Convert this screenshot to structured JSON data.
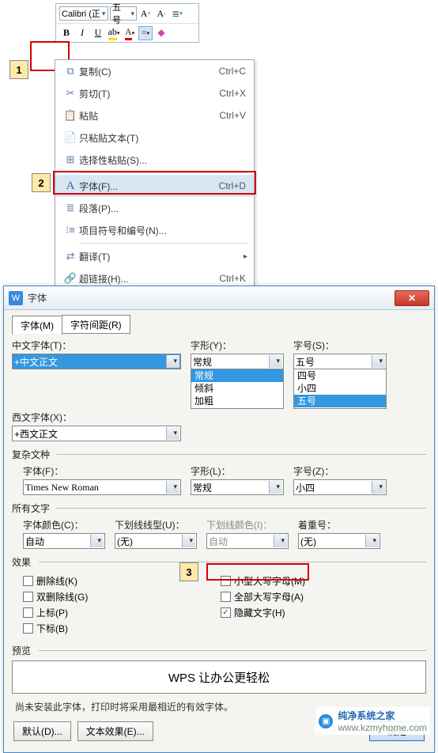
{
  "toolbar": {
    "font": "Calibri (正",
    "size": "五号",
    "bold": "B",
    "italic": "I",
    "underline": "U"
  },
  "steps": {
    "s1": "1",
    "s2": "2",
    "s3": "3"
  },
  "ctx": {
    "copy": {
      "label": "复制(C)",
      "short": "Ctrl+C"
    },
    "cut": {
      "label": "剪切(T)",
      "short": "Ctrl+X"
    },
    "paste": {
      "label": "粘贴",
      "short": "Ctrl+V"
    },
    "paste_text": {
      "label": "只粘贴文本(T)"
    },
    "paste_special": {
      "label": "选择性粘贴(S)..."
    },
    "font": {
      "label": "字体(F)...",
      "short": "Ctrl+D"
    },
    "para": {
      "label": "段落(P)..."
    },
    "bullets": {
      "label": "项目符号和编号(N)..."
    },
    "translate": {
      "label": "翻译(T)"
    },
    "hyperlink": {
      "label": "超链接(H)...",
      "short": "Ctrl+K"
    }
  },
  "dlg": {
    "title": "字体",
    "tab_font": "字体(M)",
    "tab_spacing": "字符间距(R)",
    "cn_label": "中文字体(T)：",
    "cn_val": "+中文正文",
    "style_label": "字形(Y)：",
    "style_val": "常规",
    "style_opts": [
      "常规",
      "倾斜",
      "加粗"
    ],
    "sz_label": "字号(S)：",
    "sz_val": "五号",
    "sz_opts": [
      "四号",
      "小四",
      "五号"
    ],
    "en_label": "西文字体(X)：",
    "en_val": "+西文正文",
    "complex": "复杂文种",
    "c_font_label": "字体(F)：",
    "c_font_val": "Times New Roman",
    "c_style_label": "字形(L)：",
    "c_style_val": "常规",
    "c_sz_label": "字号(Z)：",
    "c_sz_val": "小四",
    "all_text": "所有文字",
    "color_label": "字体颜色(C)：",
    "color_val": "自动",
    "ul_label": "下划线线型(U)：",
    "ul_val": "(无)",
    "ulc_label": "下划线颜色(I)：",
    "ulc_val": "自动",
    "emph_label": "着重号：",
    "emph_val": "(无)",
    "effects": "效果",
    "strike": "删除线(K)",
    "dstrike": "双删除线(G)",
    "sup": "上标(P)",
    "sub": "下标(B)",
    "smallcaps": "小型大写字母(M)",
    "allcaps": "全部大写字母(A)",
    "hidden": "隐藏文字(H)",
    "preview": "预览",
    "preview_text": "WPS 让办公更轻松",
    "note": "尚未安装此字体，打印时将采用最相近的有效字体。",
    "default": "默认(D)...",
    "texteffect": "文本效果(E)...",
    "ok": "确定"
  },
  "wm": {
    "brand": "纯净系统之家",
    "url": "www.kzmyhome.com"
  }
}
